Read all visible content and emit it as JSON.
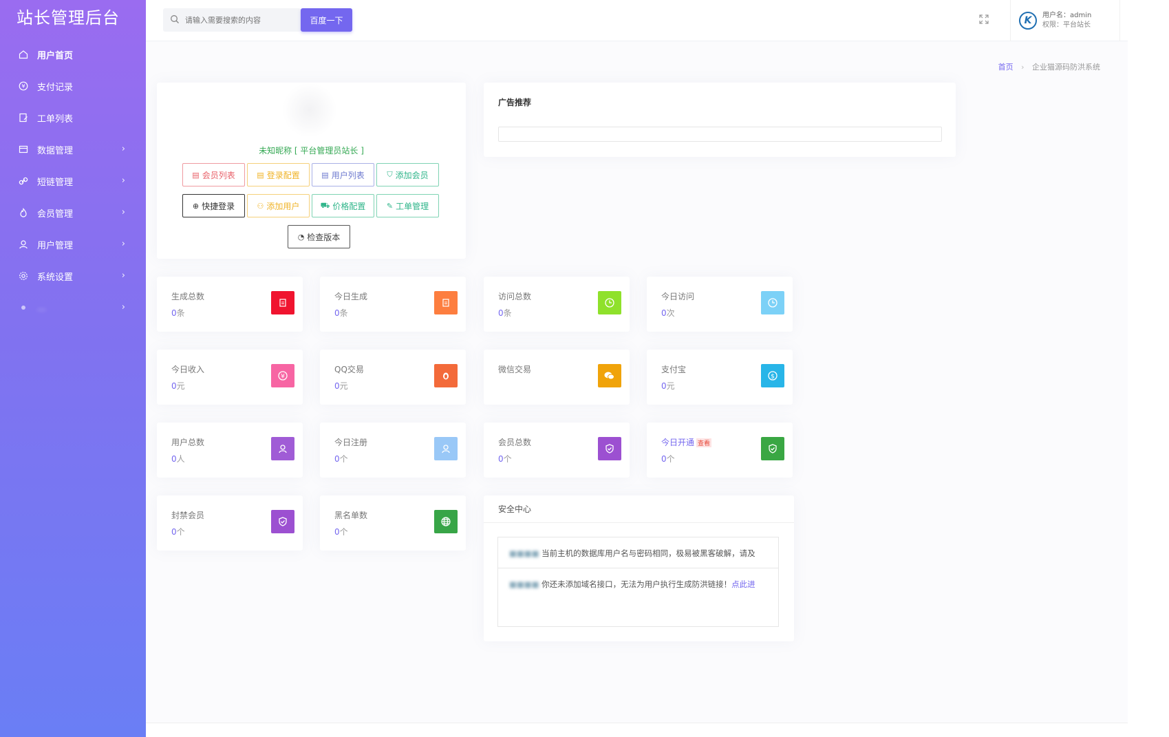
{
  "app": {
    "title": "站长管理后台"
  },
  "sidebar": {
    "items": [
      {
        "label": "用户首页",
        "icon": "home-icon",
        "has_children": false,
        "active": true
      },
      {
        "label": "支付记录",
        "icon": "yen-circle-icon",
        "has_children": false
      },
      {
        "label": "工单列表",
        "icon": "edit-doc-icon",
        "has_children": false
      },
      {
        "label": "数据管理",
        "icon": "database-icon",
        "has_children": true
      },
      {
        "label": "短链管理",
        "icon": "link-icon",
        "has_children": true
      },
      {
        "label": "会员管理",
        "icon": "fire-icon",
        "has_children": true
      },
      {
        "label": "用户管理",
        "icon": "user-icon",
        "has_children": true
      },
      {
        "label": "系统设置",
        "icon": "gear-icon",
        "has_children": true
      },
      {
        "label": "…",
        "icon": "misc-icon",
        "has_children": true
      }
    ],
    "arrow": "›"
  },
  "header": {
    "search_placeholder": "请输入需要搜索的内容",
    "search_button": "百度一下",
    "user_label": "用户名：admin",
    "role_label": "权限：平台站长",
    "avatar_letter": "K"
  },
  "breadcrumb": {
    "home": "首页",
    "sep": "›",
    "current": "企业猫源码防洪系统"
  },
  "profile": {
    "nickname": "未知昵称 [ 平台管理员站长 ]",
    "buttons": [
      {
        "label": "会员列表",
        "icon": "doc-icon",
        "color": "#e8616a"
      },
      {
        "label": "登录配置",
        "icon": "doc-icon",
        "color": "#f0b429"
      },
      {
        "label": "用户列表",
        "icon": "doc-icon",
        "color": "#7a86d8"
      },
      {
        "label": "添加会员",
        "icon": "shield-check-icon",
        "color": "#2fb58a"
      },
      {
        "label": "快捷登录",
        "icon": "plus-circle-icon",
        "color": "#333333"
      },
      {
        "label": "添加用户",
        "icon": "user-icon",
        "color": "#f0b429"
      },
      {
        "label": "价格配置",
        "icon": "cart-icon",
        "color": "#2fb58a"
      },
      {
        "label": "工单管理",
        "icon": "edit-doc-icon",
        "color": "#2fb58a"
      },
      {
        "label": "检查版本",
        "icon": "gauge-icon",
        "color": "#555555"
      }
    ]
  },
  "ad": {
    "title": "广告推荐"
  },
  "stats": [
    {
      "label": "生成总数",
      "value": "0",
      "unit": "条",
      "icon": "doc-icon",
      "color": "#f0142f"
    },
    {
      "label": "今日生成",
      "value": "0",
      "unit": "条",
      "icon": "doc-icon",
      "color": "#fd7e3f"
    },
    {
      "label": "访问总数",
      "value": "0",
      "unit": "条",
      "icon": "clock-icon",
      "color": "#8fe12b"
    },
    {
      "label": "今日访问",
      "value": "0",
      "unit": "次",
      "icon": "clock-icon",
      "color": "#7cd1f7"
    },
    {
      "label": "今日收入",
      "value": "0",
      "unit": "元",
      "icon": "yen-circle-icon",
      "color": "#f765a3"
    },
    {
      "label": "QQ交易",
      "value": "0",
      "unit": "元",
      "icon": "qq-icon",
      "color": "#f36a3a"
    },
    {
      "label": "微信交易",
      "value": "",
      "unit": "",
      "icon": "wechat-icon",
      "color": "#f0a30a"
    },
    {
      "label": "支付宝",
      "value": "0",
      "unit": "元",
      "icon": "alipay-icon",
      "color": "#28b5e8"
    },
    {
      "label": "用户总数",
      "value": "0",
      "unit": "人",
      "icon": "user-icon",
      "color": "#a05cd6"
    },
    {
      "label": "今日注册",
      "value": "0",
      "unit": "个",
      "icon": "user-icon",
      "color": "#99c8f7"
    },
    {
      "label": "会员总数",
      "value": "0",
      "unit": "个",
      "icon": "shield-check-icon",
      "color": "#9c50d1"
    },
    {
      "label": "今日开通",
      "value": "0",
      "unit": "个",
      "icon": "shield-check-icon",
      "color": "#3aa743",
      "badge": "查看"
    },
    {
      "label": "封禁会员",
      "value": "0",
      "unit": "个",
      "icon": "shield-check-icon",
      "color": "#9c50d1"
    },
    {
      "label": "黑名单数",
      "value": "0",
      "unit": "个",
      "icon": "globe-icon",
      "color": "#38a547"
    }
  ],
  "security": {
    "title": "安全中心",
    "items": [
      {
        "text": "当前主机的数据库用户名与密码相同，极易被黑客破解，请及",
        "link": ""
      },
      {
        "text": "你还未添加域名接口，无法为用户执行生成防洪链接！",
        "link": "点此进"
      }
    ]
  }
}
